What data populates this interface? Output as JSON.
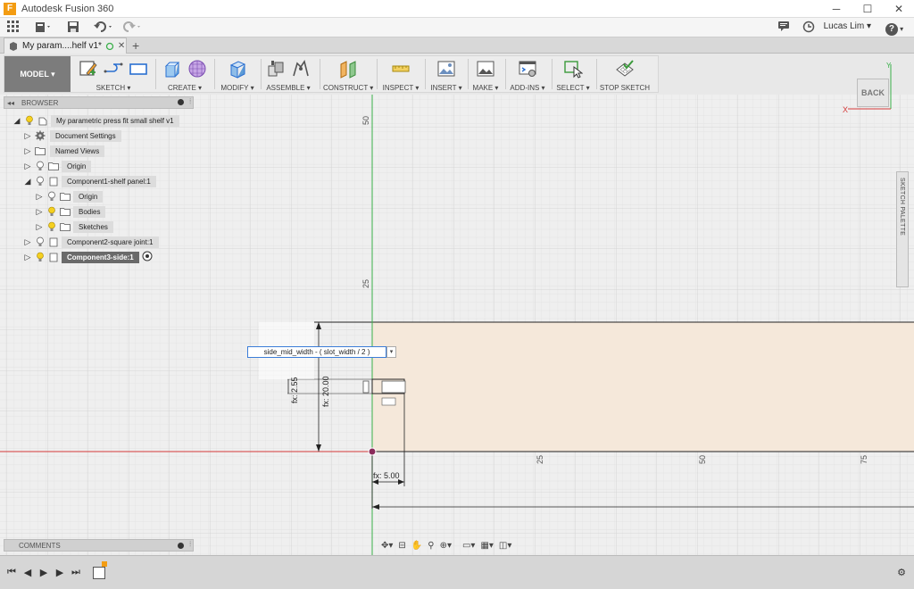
{
  "window": {
    "title": "Autodesk Fusion 360",
    "logo_letter": "F",
    "minimize": "─",
    "maximize": "☐",
    "close": "✕"
  },
  "menubar": {
    "user_name": "Lucas Lim ▾",
    "help": "?"
  },
  "doc_tab": {
    "name": "My param....helf v1*",
    "close": "✕",
    "new_tab": "+"
  },
  "toolbar": {
    "workspace": "MODEL ▾",
    "groups": [
      {
        "label": "SKETCH ▾"
      },
      {
        "label": "CREATE ▾"
      },
      {
        "label": "MODIFY ▾"
      },
      {
        "label": "ASSEMBLE ▾"
      },
      {
        "label": "CONSTRUCT ▾"
      },
      {
        "label": "INSPECT ▾"
      },
      {
        "label": "INSERT ▾"
      },
      {
        "label": "MAKE ▾"
      },
      {
        "label": "ADD-INS ▾"
      },
      {
        "label": "SELECT ▾"
      },
      {
        "label": "STOP SKETCH"
      }
    ]
  },
  "browser": {
    "title": "BROWSER",
    "items": [
      {
        "label": "My parametric press fit small shelf v1",
        "expanded": true
      },
      {
        "label": "Document Settings",
        "expanded": false
      },
      {
        "label": "Named Views",
        "expanded": false
      },
      {
        "label": "Origin",
        "expanded": false
      },
      {
        "label": "Component1-shelf panel:1",
        "expanded": true
      },
      {
        "label": "Origin",
        "expanded": false
      },
      {
        "label": "Bodies",
        "expanded": false
      },
      {
        "label": "Sketches",
        "expanded": false
      },
      {
        "label": "Component2-square joint:1",
        "expanded": false
      },
      {
        "label": "Component3-side:1",
        "expanded": false,
        "active": true
      }
    ]
  },
  "comments": {
    "title": "COMMENTS"
  },
  "viewcube": {
    "face": "BACK",
    "x_axis": "X",
    "y_axis": "Y"
  },
  "sketch_palette": {
    "label": "SKETCH PALETTE"
  },
  "canvas": {
    "ruler_labels_vertical": [
      "50",
      "25"
    ],
    "ruler_labels_horizontal": [
      "25",
      "50",
      "75"
    ],
    "dim_height": "fx: 20.00",
    "dim_small": "fx: 2.55",
    "dim_width": "fx: 5.00",
    "expression_input": "side_mid_width - ( slot_width / 2 )",
    "expression_dropdown": "▾"
  },
  "colors": {
    "accent": "#3b7dd8",
    "grid_bg": "#efefef",
    "grid_line": "#dcdcdc",
    "body_fill": "#f5e8da",
    "x_axis": "#d43a3a",
    "y_axis": "#3ab04a",
    "workspace_btn": "#7c7c7c"
  }
}
